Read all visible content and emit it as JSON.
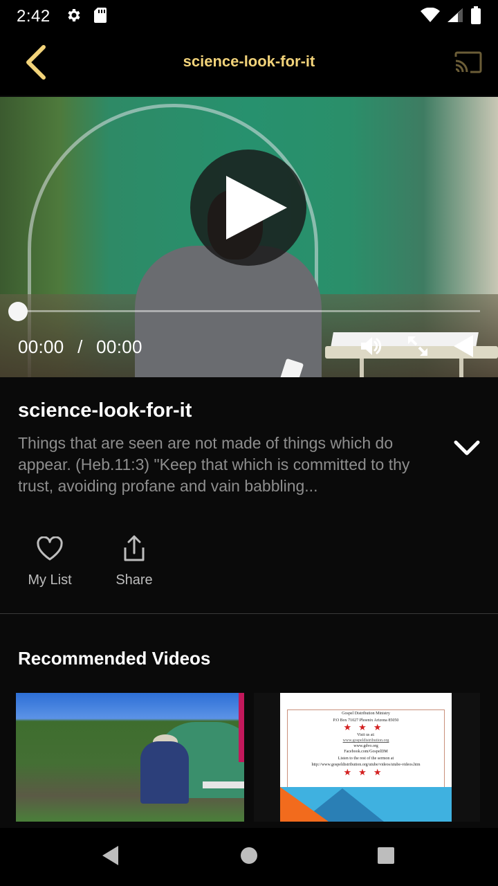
{
  "status": {
    "time": "2:42",
    "icons": [
      "settings-icon",
      "sd-card-icon",
      "wifi-icon",
      "signal-icon",
      "battery-icon"
    ]
  },
  "appbar": {
    "title": "science-look-for-it",
    "back_icon": "chevron-left-icon",
    "cast_icon": "cast-icon",
    "accent_color": "#f2d37a"
  },
  "player": {
    "current_time": "00:00",
    "separator": "/",
    "duration": "00:00",
    "progress": 0,
    "icons": [
      "play-icon",
      "volume-icon",
      "fullscreen-icon",
      "rewind-icon"
    ]
  },
  "video": {
    "title": "science-look-for-it",
    "description": "Things that are seen are not made of things which do appear. (Heb.11:3) \"Keep that which is committed to thy trust, avoiding profane and vain babbling...",
    "expand_icon": "chevron-down-icon"
  },
  "actions": [
    {
      "label": "My List",
      "icon": "heart-icon"
    },
    {
      "label": "Share",
      "icon": "share-icon"
    }
  ],
  "recommended": {
    "title": "Recommended Videos",
    "items": [
      {
        "type": "video-thumbnail"
      },
      {
        "type": "slide-thumbnail",
        "lines": [
          "Gospel Distribution Ministry",
          "P.O Box 71027 Phoenix Arizona 85050",
          "Visit us at:",
          "www.gospeldistribution.org",
          "www.gdvo.org",
          "Facebook.com/GospelDM",
          "Listen to the rest of the sermon at",
          "http://www.gospeldistribution.org/utube/videos/utube-videos.htm"
        ]
      }
    ]
  },
  "navbar": {
    "icons": [
      "back-triangle-icon",
      "home-circle-icon",
      "recents-square-icon"
    ]
  }
}
